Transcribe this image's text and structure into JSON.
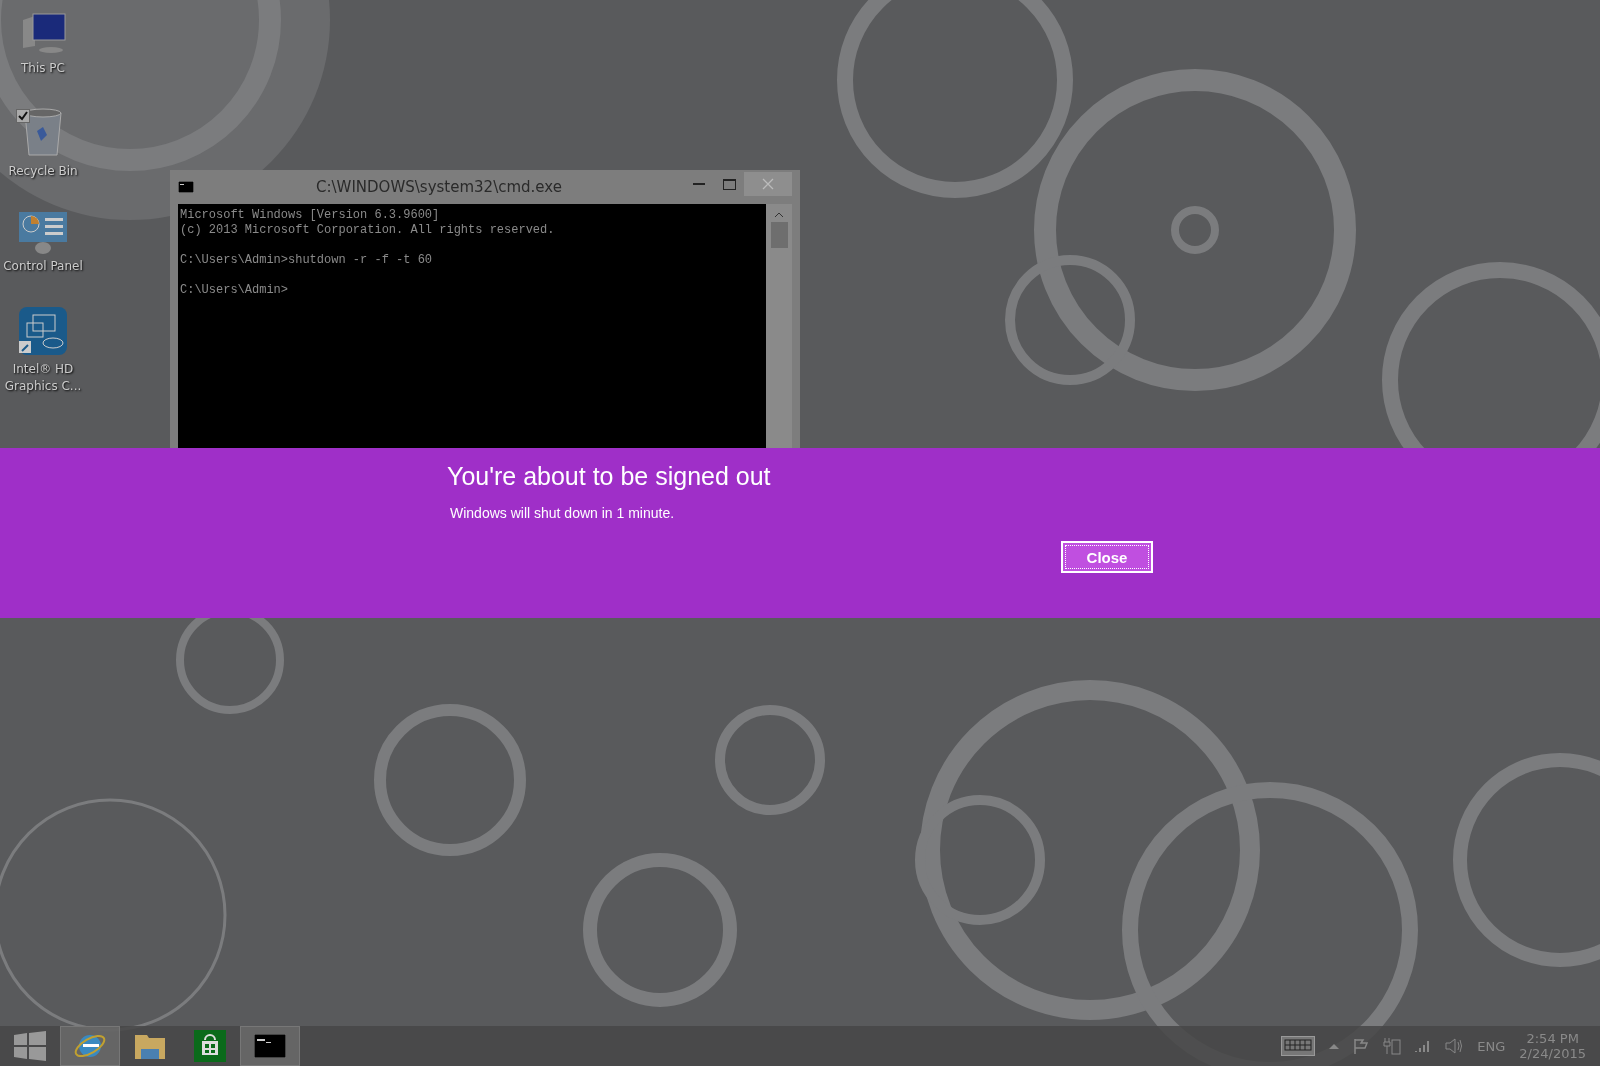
{
  "desktop_icons": [
    {
      "kind": "pc",
      "label": "This PC",
      "checked": false
    },
    {
      "kind": "bin",
      "label": "Recycle Bin",
      "checked": true
    },
    {
      "kind": "panel",
      "label": "Control Panel",
      "checked": false
    },
    {
      "kind": "intel",
      "label": "Intel® HD Graphics C...",
      "checked": false
    }
  ],
  "console_window": {
    "title": "C:\\WINDOWS\\system32\\cmd.exe",
    "paragraphs": [
      [
        "Microsoft Windows [Version 6.3.9600]",
        "(c) 2013 Microsoft Corporation. All rights reserved."
      ],
      [
        "C:\\Users\\Admin>shutdown -r -f -t 60"
      ],
      [
        "C:\\Users\\Admin>"
      ]
    ]
  },
  "notification": {
    "title": "You're about to be signed out",
    "message": "Windows will shut down in 1 minute.",
    "button": "Close"
  },
  "taskbar": {
    "apps": [
      {
        "kind": "ie",
        "running": true
      },
      {
        "kind": "explorer",
        "running": false
      },
      {
        "kind": "store",
        "running": false
      },
      {
        "kind": "cmd",
        "running": true
      }
    ],
    "tray": {
      "language": "ENG",
      "time": "2:54 PM",
      "date": "2/24/2015"
    }
  }
}
